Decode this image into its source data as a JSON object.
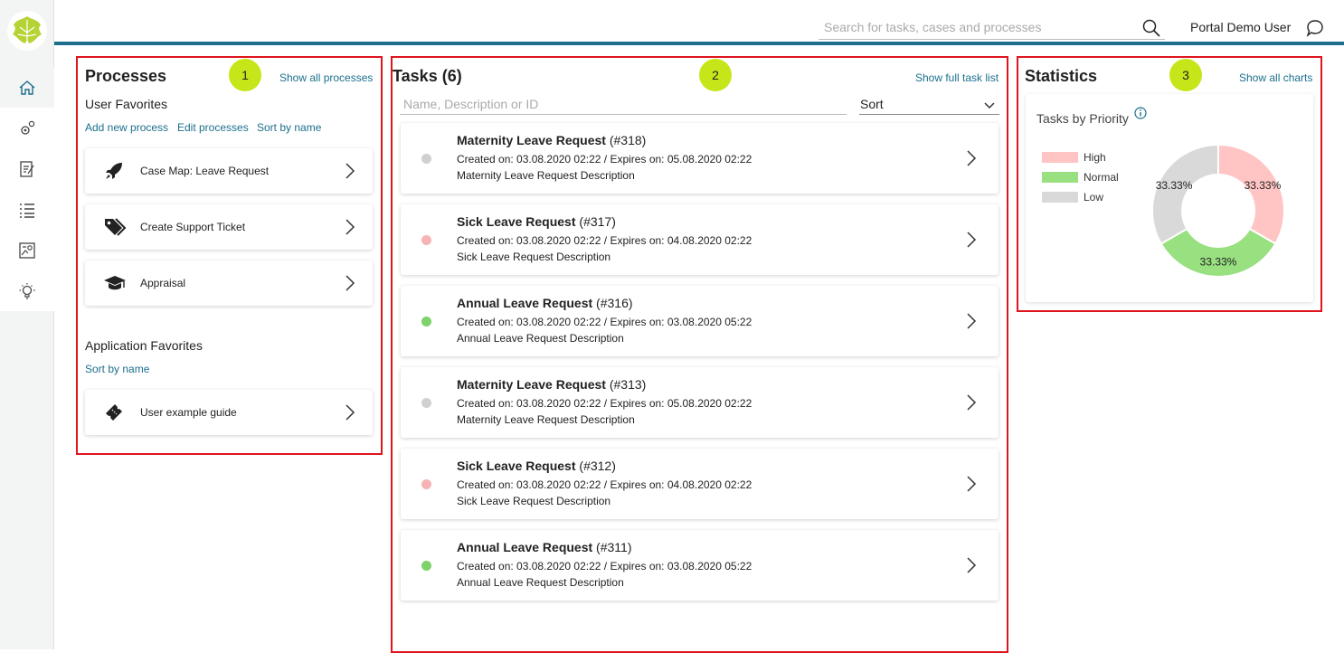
{
  "header": {
    "search_placeholder": "Search for tasks, cases and processes",
    "user_name": "Portal Demo User"
  },
  "sidebar": {
    "items": [
      {
        "icon": "home-icon",
        "active": true
      },
      {
        "icon": "processes-icon",
        "active": false
      },
      {
        "icon": "tasks-icon",
        "active": false
      },
      {
        "icon": "cases-icon",
        "active": false
      },
      {
        "icon": "statistics-icon",
        "active": false
      },
      {
        "icon": "lightbulb-icon",
        "active": false
      }
    ]
  },
  "processes": {
    "badge": "1",
    "title": "Processes",
    "show_all": "Show all processes",
    "user_favorites_label": "User Favorites",
    "actions": [
      "Add new process",
      "Edit processes",
      "Sort by name"
    ],
    "user_favorites": [
      {
        "label": "Case Map: Leave Request",
        "icon": "rocket-icon"
      },
      {
        "label": "Create Support Ticket",
        "icon": "tags-icon"
      },
      {
        "label": "Appraisal",
        "icon": "graduation-cap-icon"
      }
    ],
    "app_favorites_label": "Application Favorites",
    "app_sort": "Sort by name",
    "app_favorites": [
      {
        "label": "User example guide",
        "icon": "ticket-icon"
      }
    ]
  },
  "tasks": {
    "badge": "2",
    "title": "Tasks (6)",
    "show_full": "Show full task list",
    "filter_placeholder": "Name, Description or ID",
    "sort_label": "Sort",
    "items": [
      {
        "name": "Maternity Leave Request",
        "id": "(#318)",
        "dates": "Created on: 03.08.2020 02:22 / Expires on: 05.08.2020 02:22",
        "desc": "Maternity Leave Request Description",
        "priority": "low"
      },
      {
        "name": "Sick Leave Request",
        "id": "(#317)",
        "dates": "Created on: 03.08.2020 02:22 / Expires on: 04.08.2020 02:22",
        "desc": "Sick Leave Request Description",
        "priority": "high"
      },
      {
        "name": "Annual Leave Request",
        "id": "(#316)",
        "dates": "Created on: 03.08.2020 02:22 / Expires on: 03.08.2020 05:22",
        "desc": "Annual Leave Request Description",
        "priority": "normal"
      },
      {
        "name": "Maternity Leave Request",
        "id": "(#313)",
        "dates": "Created on: 03.08.2020 02:22 / Expires on: 05.08.2020 02:22",
        "desc": "Maternity Leave Request Description",
        "priority": "low"
      },
      {
        "name": "Sick Leave Request",
        "id": "(#312)",
        "dates": "Created on: 03.08.2020 02:22 / Expires on: 04.08.2020 02:22",
        "desc": "Sick Leave Request Description",
        "priority": "high"
      },
      {
        "name": "Annual Leave Request",
        "id": "(#311)",
        "dates": "Created on: 03.08.2020 02:22 / Expires on: 03.08.2020 05:22",
        "desc": "Annual Leave Request Description",
        "priority": "normal"
      }
    ]
  },
  "statistics": {
    "badge": "3",
    "title": "Statistics",
    "show_all": "Show all charts",
    "chart_title": "Tasks by Priority",
    "legend": [
      {
        "label": "High",
        "color": "#ffc4c4"
      },
      {
        "label": "Normal",
        "color": "#98e080"
      },
      {
        "label": "Low",
        "color": "#d9d9d9"
      }
    ],
    "slices": [
      {
        "label": "High",
        "value": 33.33,
        "text": "33.33%",
        "color": "#ffc4c4"
      },
      {
        "label": "Normal",
        "value": 33.33,
        "text": "33.33%",
        "color": "#98e080"
      },
      {
        "label": "Low",
        "value": 33.33,
        "text": "33.33%",
        "color": "#d9d9d9"
      }
    ]
  },
  "colors": {
    "accent": "#1b6f8d",
    "highlight_border": "#e0141e",
    "badge": "#c6e619",
    "priority_low": "#d0d0d0",
    "priority_high": "#f7b3b3",
    "priority_normal": "#7dd36a"
  }
}
